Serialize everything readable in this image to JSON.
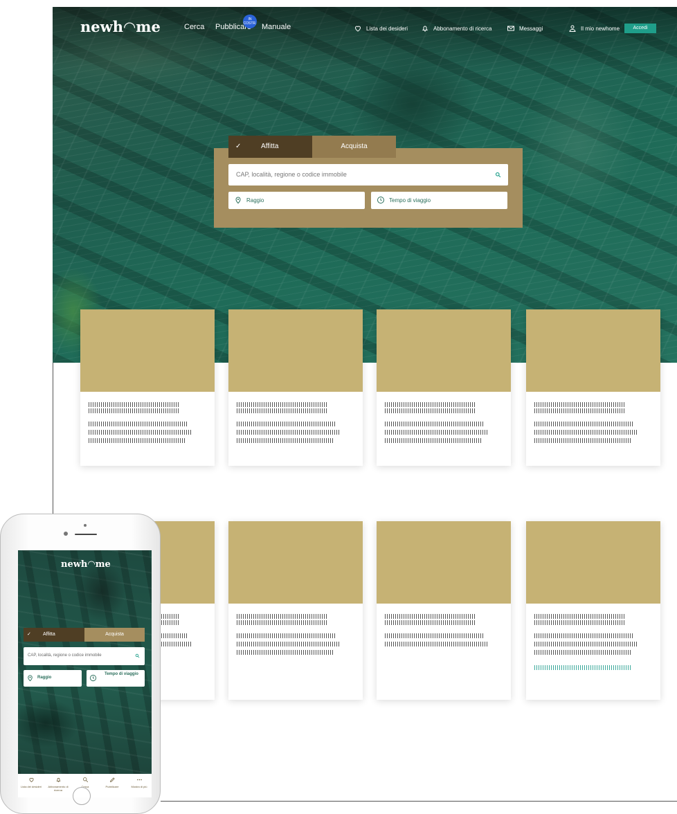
{
  "desktop": {
    "logo": "newh◠me",
    "nav": {
      "cerca": "Cerca",
      "pubblicare": "Pubblicare",
      "manuale": "Manuale",
      "badge": "IN COSTR."
    },
    "top_links": {
      "wishlist": "Lista dei desideri",
      "subscription": "Abbonamento di ricerca",
      "messages": "Messaggi",
      "my_account": "Il mio newhome",
      "login": "Accedi"
    },
    "search": {
      "tab_rent": "Affitta",
      "tab_buy": "Acquista",
      "check": "✓",
      "placeholder": "CAP, località, regione o codice immobile",
      "radius": "Raggio",
      "travel_time": "Tempo di viaggio"
    }
  },
  "mobile": {
    "logo": "newh◠me",
    "search": {
      "tab_rent": "Affitta",
      "tab_buy": "Acquista",
      "check": "✓",
      "placeholder": "CAP, località, regione o codice immobile",
      "radius": "Raggio",
      "travel_time": "Tempo di viaggio"
    },
    "tabbar": [
      {
        "label": "Lista dei desideri",
        "icon": "heart-icon"
      },
      {
        "label": "Abbonamento di ricerca",
        "icon": "bell-icon"
      },
      {
        "label": "Cerca",
        "icon": "search-icon"
      },
      {
        "label": "Pubblicare",
        "icon": "pencil-icon"
      },
      {
        "label": "Mostra di più",
        "icon": "more-icon"
      }
    ]
  },
  "colors": {
    "card_image": "#c6b274",
    "search_panel": "#a58e5f",
    "tab_active": "#4f3e24",
    "accent_teal": "#1f9e8a",
    "badge_blue": "#2b63d8"
  }
}
